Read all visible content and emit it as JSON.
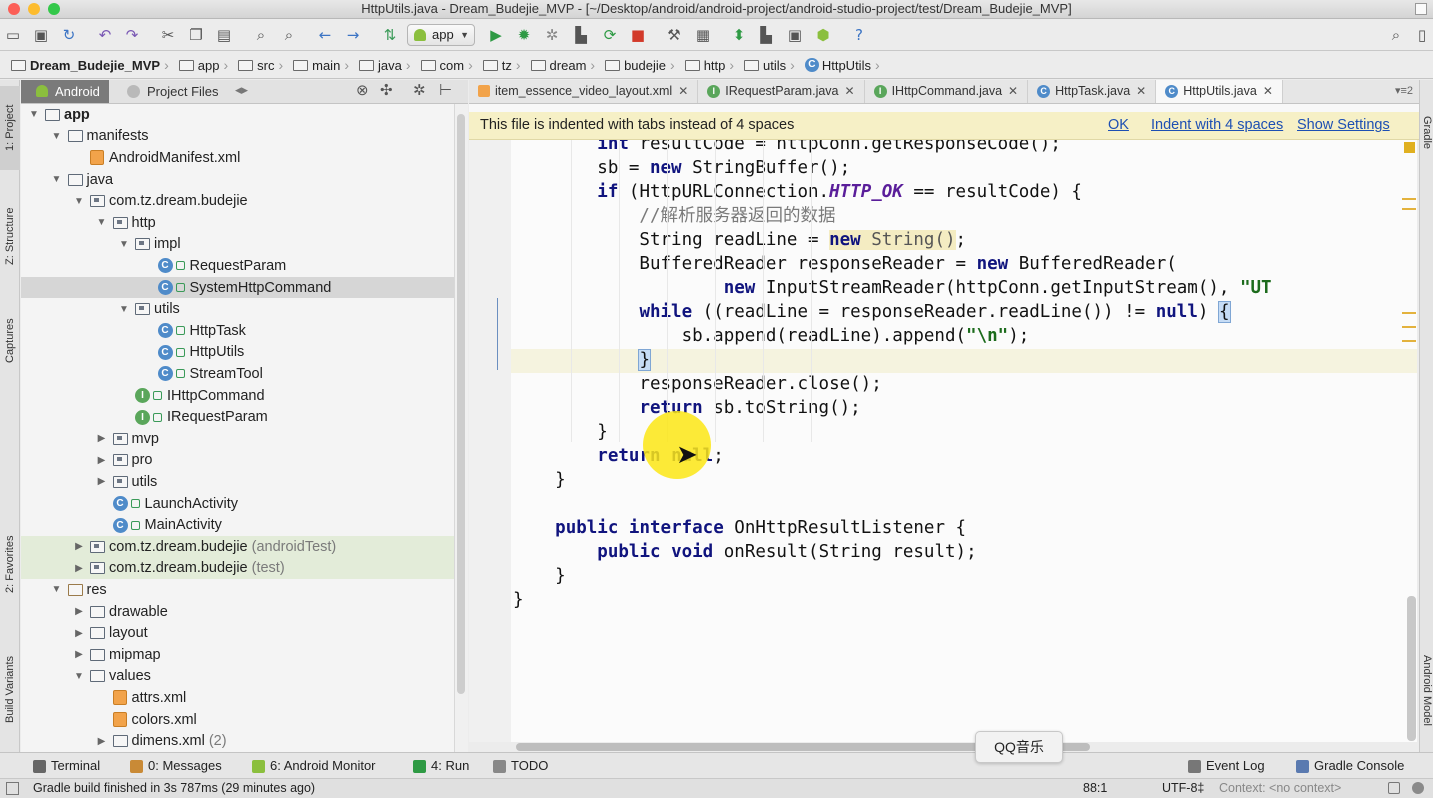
{
  "window": {
    "title": "HttpUtils.java - Dream_Budejie_MVP - [~/Desktop/android/android-project/android-studio-project/test/Dream_Budejie_MVP]"
  },
  "toolbar": {
    "run_config": "app",
    "help": "?"
  },
  "breadcrumbs": [
    "Dream_Budejie_MVP",
    "app",
    "src",
    "main",
    "java",
    "com",
    "tz",
    "dream",
    "budejie",
    "http",
    "utils",
    "HttpUtils"
  ],
  "left_stripe": {
    "project": "1: Project",
    "structure": "Z: Structure",
    "captures": "Captures",
    "favorites": "2: Favorites",
    "build_variants": "Build Variants"
  },
  "right_stripe": {
    "gradle": "Gradle",
    "android_model": "Android Model"
  },
  "project_panel": {
    "view_android": "Android",
    "view_project_files": "Project Files"
  },
  "tree": [
    {
      "label": "app",
      "kind": "module",
      "indent": 0,
      "arrow": "▼"
    },
    {
      "label": "manifests",
      "kind": "folder",
      "indent": 1,
      "arrow": "▼"
    },
    {
      "label": "AndroidManifest.xml",
      "kind": "xml",
      "indent": 2,
      "arrow": ""
    },
    {
      "label": "java",
      "kind": "folder",
      "indent": 1,
      "arrow": "▼"
    },
    {
      "label": "com.tz.dream.budejie",
      "kind": "package",
      "indent": 2,
      "arrow": "▼"
    },
    {
      "label": "http",
      "kind": "package",
      "indent": 3,
      "arrow": "▼"
    },
    {
      "label": "impl",
      "kind": "package",
      "indent": 4,
      "arrow": "▼"
    },
    {
      "label": "RequestParam",
      "kind": "class",
      "indent": 5,
      "arrow": ""
    },
    {
      "label": "SystemHttpCommand",
      "kind": "class",
      "indent": 5,
      "arrow": "",
      "selected": true
    },
    {
      "label": "utils",
      "kind": "package",
      "indent": 4,
      "arrow": "▼"
    },
    {
      "label": "HttpTask",
      "kind": "class",
      "indent": 5,
      "arrow": ""
    },
    {
      "label": "HttpUtils",
      "kind": "class",
      "indent": 5,
      "arrow": ""
    },
    {
      "label": "StreamTool",
      "kind": "class",
      "indent": 5,
      "arrow": ""
    },
    {
      "label": "IHttpCommand",
      "kind": "interface",
      "indent": 4,
      "arrow": ""
    },
    {
      "label": "IRequestParam",
      "kind": "interface",
      "indent": 4,
      "arrow": ""
    },
    {
      "label": "mvp",
      "kind": "package",
      "indent": 3,
      "arrow": "▶"
    },
    {
      "label": "pro",
      "kind": "package",
      "indent": 3,
      "arrow": "▶"
    },
    {
      "label": "utils",
      "kind": "package",
      "indent": 3,
      "arrow": "▶"
    },
    {
      "label": "LaunchActivity",
      "kind": "class",
      "indent": 3,
      "arrow": ""
    },
    {
      "label": "MainActivity",
      "kind": "class",
      "indent": 3,
      "arrow": ""
    },
    {
      "label": "com.tz.dream.budejie",
      "kind": "package",
      "indent": 2,
      "arrow": "▶",
      "suffix": "(androidTest)",
      "tinted": true
    },
    {
      "label": "com.tz.dream.budejie",
      "kind": "package",
      "indent": 2,
      "arrow": "▶",
      "suffix": "(test)",
      "tinted": true
    },
    {
      "label": "res",
      "kind": "res",
      "indent": 1,
      "arrow": "▼"
    },
    {
      "label": "drawable",
      "kind": "folder",
      "indent": 2,
      "arrow": "▶"
    },
    {
      "label": "layout",
      "kind": "folder",
      "indent": 2,
      "arrow": "▶"
    },
    {
      "label": "mipmap",
      "kind": "folder",
      "indent": 2,
      "arrow": "▶"
    },
    {
      "label": "values",
      "kind": "folder",
      "indent": 2,
      "arrow": "▼"
    },
    {
      "label": "attrs.xml",
      "kind": "xml",
      "indent": 3,
      "arrow": ""
    },
    {
      "label": "colors.xml",
      "kind": "xml",
      "indent": 3,
      "arrow": ""
    },
    {
      "label": "dimens.xml",
      "kind": "folder",
      "indent": 3,
      "arrow": "▶",
      "suffix": "(2)"
    }
  ],
  "editor_tabs": [
    {
      "label": "item_essence_video_layout.xml",
      "type": "xml"
    },
    {
      "label": "IRequestParam.java",
      "type": "interface"
    },
    {
      "label": "IHttpCommand.java",
      "type": "interface"
    },
    {
      "label": "HttpTask.java",
      "type": "class"
    },
    {
      "label": "HttpUtils.java",
      "type": "class",
      "active": true
    }
  ],
  "banner": {
    "message": "This file is indented with tabs instead of 4 spaces",
    "ok": "OK",
    "indent": "Indent with 4 spaces",
    "settings": "Show Settings"
  },
  "code_lines": [
    "        int resultCode = httpConn.getResponseCode();",
    "        sb = new StringBuffer();",
    "        if (HttpURLConnection.HTTP_OK == resultCode) {",
    "            //解析服务器返回的数据",
    "            String readLine = new String();",
    "            BufferedReader responseReader = new BufferedReader(",
    "                    new InputStreamReader(httpConn.getInputStream(), \"UT",
    "            while ((readLine = responseReader.readLine()) != null) {",
    "                sb.append(readLine).append(\"\\n\");",
    "            }",
    "            responseReader.close();",
    "            return sb.toString();",
    "        }",
    "        return null;",
    "    }",
    "",
    "    public interface OnHttpResultListener {",
    "        public void onResult(String result);",
    "    }",
    "}"
  ],
  "tool_windows": [
    {
      "label": "Terminal"
    },
    {
      "label": "0: Messages"
    },
    {
      "label": "6: Android Monitor"
    },
    {
      "label": "4: Run"
    },
    {
      "label": "TODO"
    },
    {
      "label": "Event Log"
    },
    {
      "label": "Gradle Console"
    }
  ],
  "tooltip": "QQ音乐",
  "status": {
    "message": "Gradle build finished in 3s 787ms (29 minutes ago)",
    "position": "88:1",
    "encoding": "UTF-8‡",
    "context": "Context: <no context>"
  }
}
